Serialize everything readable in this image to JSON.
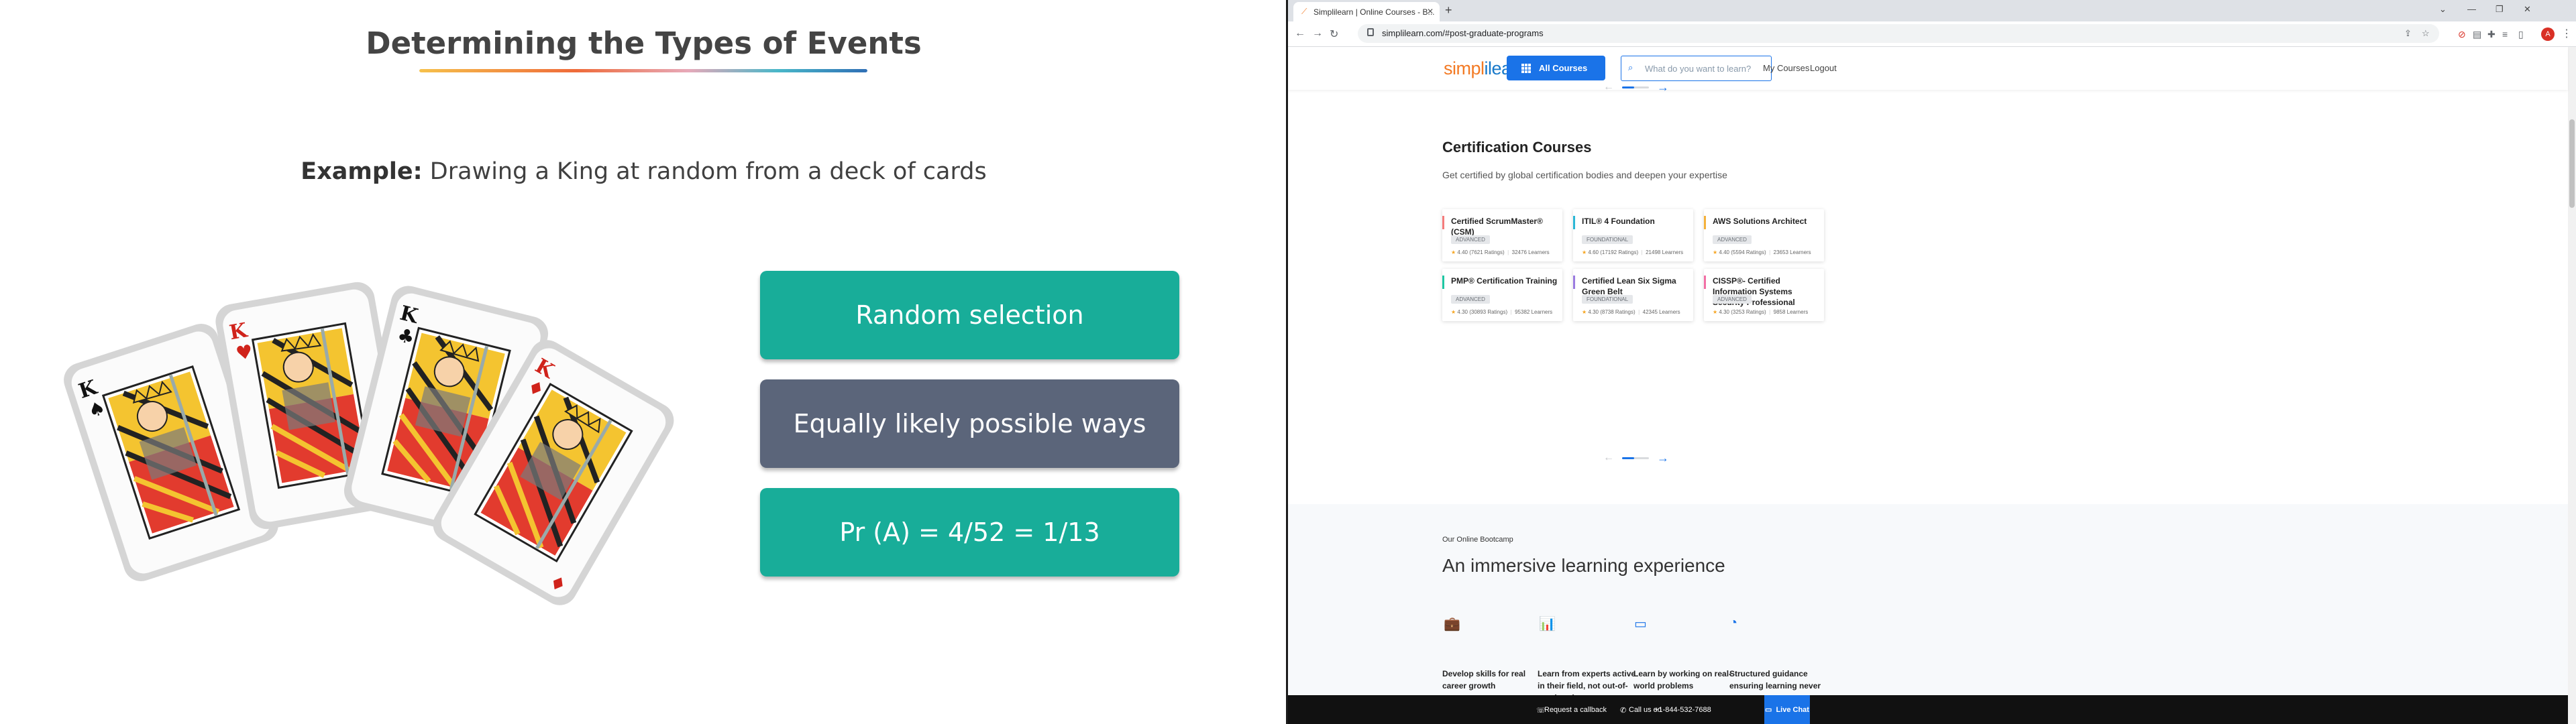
{
  "slide": {
    "title": "Determining the Types of Events",
    "example_label": "Example:",
    "example_text": " Drawing a King at random from a deck of cards",
    "pills": [
      "Random selection",
      "Equally likely possible ways",
      "Pr (A) = 4/52 = 1/13"
    ],
    "colors": {
      "teal": "#18ad99",
      "slate": "#5b657a"
    }
  },
  "browser": {
    "tab_title": "Simplilearn | Online Courses - B...",
    "new_tab": "+",
    "url": "simplilearn.com/#post-graduate-programs",
    "profile_initial": "A"
  },
  "site": {
    "logo_a": "simpl",
    "logo_b": "ilearn",
    "all_courses": "All Courses",
    "search_placeholder": "What do you want to learn?",
    "my_courses": "My Courses",
    "logout": "Logout",
    "section_title": "Certification Courses",
    "section_sub": "Get certified by global certification bodies and deepen your expertise",
    "cards": [
      {
        "title": "Certified ScrumMaster® (CSM)",
        "level": "ADVANCED",
        "rating": "4.40 (7621 Ratings)",
        "learners": "32476 Learners",
        "accent": "#f47c7c"
      },
      {
        "title": "ITIL® 4 Foundation",
        "level": "FOUNDATIONAL",
        "rating": "4.60 (17192 Ratings)",
        "learners": "21498 Learners",
        "accent": "#2bb7d6"
      },
      {
        "title": "AWS Solutions Architect",
        "level": "ADVANCED",
        "rating": "4.40 (5594 Ratings)",
        "learners": "23653 Learners",
        "accent": "#f4b13b"
      },
      {
        "title": "PMP® Certification Training",
        "level": "ADVANCED",
        "rating": "4.30 (30893 Ratings)",
        "learners": "95382 Learners",
        "accent": "#1ec7a3"
      },
      {
        "title": "Certified Lean Six Sigma Green Belt",
        "level": "FOUNDATIONAL",
        "rating": "4.30 (8738 Ratings)",
        "learners": "42345 Learners",
        "accent": "#9b7be0"
      },
      {
        "title": "CISSP®- Certified Information Systems Security Professional",
        "level": "ADVANCED",
        "rating": "4.30 (3253 Ratings)",
        "learners": "9858 Learners",
        "accent": "#f26fa5"
      }
    ],
    "bootcamp_small": "Our Online Bootcamp",
    "bootcamp_title": "An immersive learning experience",
    "features": [
      "Develop skills for real career growth",
      "Learn from experts active in their field, not out-of-touch trainers",
      "Learn by working on real-world problems",
      "Structured guidance ensuring learning never stops"
    ],
    "bottom": {
      "callback": "Request a callback",
      "call_label": "Call us on",
      "phone": "+1-844-532-7688",
      "live_chat": "Live Chat"
    }
  }
}
